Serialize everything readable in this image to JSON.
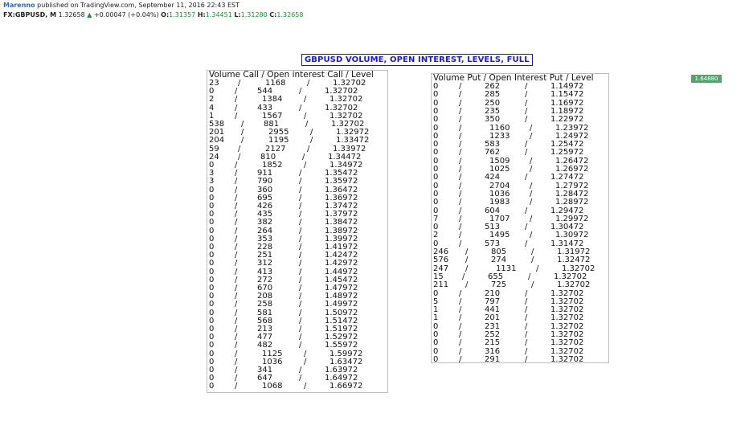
{
  "header": {
    "author": "Marenno",
    "published": "published on TradingView.com, September 11, 2016 22:43 EST",
    "symbol": "FX:GBPUSD, M",
    "last": "1.32658",
    "change": "+0.00047 (+0.04%)",
    "o_label": "O:",
    "o_value": "1.31357",
    "h_label": "H:",
    "h_value": "1.34451",
    "l_label": "L:",
    "l_value": "1.31280",
    "c_label": "C:",
    "c_value": "1.32658"
  },
  "title": "GBPUSD VOLUME, OPEN INTEREST, LEVELS, FULL",
  "price_tag": "1.64880",
  "calls": {
    "header": "Volume Call / Open interest Call / Level",
    "rows": [
      [
        "23",
        "1168",
        "1.32702"
      ],
      [
        "0",
        "544",
        "1.32702"
      ],
      [
        "2",
        "1384",
        "1.32702"
      ],
      [
        "4",
        "433",
        "1.32702"
      ],
      [
        "1",
        "1567",
        "1.32702"
      ],
      [
        "538",
        "881",
        "1.32702"
      ],
      [
        "201",
        "2955",
        "1.32972"
      ],
      [
        "204",
        "1195",
        "1.33472"
      ],
      [
        "59",
        "2127",
        "1.33972"
      ],
      [
        "24",
        "810",
        "1.34472"
      ],
      [
        "0",
        "1852",
        "1.34972"
      ],
      [
        "3",
        "911",
        "1.35472"
      ],
      [
        "3",
        "790",
        "1.35972"
      ],
      [
        "0",
        "360",
        "1.36472"
      ],
      [
        "0",
        "695",
        "1.36972"
      ],
      [
        "0",
        "426",
        "1.37472"
      ],
      [
        "0",
        "435",
        "1.37972"
      ],
      [
        "0",
        "382",
        "1.38472"
      ],
      [
        "0",
        "264",
        "1.38972"
      ],
      [
        "0",
        "353",
        "1.39972"
      ],
      [
        "0",
        "228",
        "1.41972"
      ],
      [
        "0",
        "251",
        "1.42472"
      ],
      [
        "0",
        "312",
        "1.42972"
      ],
      [
        "0",
        "413",
        "1.44972"
      ],
      [
        "0",
        "272",
        "1.45472"
      ],
      [
        "0",
        "670",
        "1.47972"
      ],
      [
        "0",
        "208",
        "1.48972"
      ],
      [
        "0",
        "258",
        "1.49972"
      ],
      [
        "0",
        "581",
        "1.50972"
      ],
      [
        "0",
        "568",
        "1.51472"
      ],
      [
        "0",
        "213",
        "1.51972"
      ],
      [
        "0",
        "477",
        "1.52972"
      ],
      [
        "0",
        "482",
        "1.55972"
      ],
      [
        "0",
        "1125",
        "1.59972"
      ],
      [
        "0",
        "1036",
        "1.63472"
      ],
      [
        "0",
        "341",
        "1.63972"
      ],
      [
        "0",
        "647",
        "1.64972"
      ],
      [
        "0",
        "1068",
        "1.66972"
      ]
    ]
  },
  "puts": {
    "header": "Volume Put / Open Interest Put / Level",
    "rows": [
      [
        "0",
        "262",
        "1.14972"
      ],
      [
        "0",
        "285",
        "1.15472"
      ],
      [
        "0",
        "250",
        "1.16972"
      ],
      [
        "0",
        "235",
        "1.18972"
      ],
      [
        "0",
        "350",
        "1.22972"
      ],
      [
        "0",
        "1160",
        "1.23972"
      ],
      [
        "0",
        "1233",
        "1.24972"
      ],
      [
        "0",
        "583",
        "1.25472"
      ],
      [
        "0",
        "762",
        "1.25972"
      ],
      [
        "0",
        "1509",
        "1.26472"
      ],
      [
        "0",
        "1025",
        "1.26972"
      ],
      [
        "0",
        "424",
        "1.27472"
      ],
      [
        "0",
        "2704",
        "1.27972"
      ],
      [
        "0",
        "1036",
        "1.28472"
      ],
      [
        "0",
        "1983",
        "1.28972"
      ],
      [
        "0",
        "604",
        "1.29472"
      ],
      [
        "7",
        "1707",
        "1.29972"
      ],
      [
        "0",
        "513",
        "1.30472"
      ],
      [
        "2",
        "1495",
        "1.30972"
      ],
      [
        "0",
        "573",
        "1.31472"
      ],
      [
        "246",
        "805",
        "1.31972"
      ],
      [
        "576",
        "274",
        "1.32472"
      ],
      [
        "247",
        "1131",
        "1.32702"
      ],
      [
        "15",
        "655",
        "1.32702"
      ],
      [
        "211",
        "725",
        "1.32702"
      ],
      [
        "0",
        "210",
        "1.32702"
      ],
      [
        "5",
        "797",
        "1.32702"
      ],
      [
        "1",
        "441",
        "1.32702"
      ],
      [
        "1",
        "201",
        "1.32702"
      ],
      [
        "0",
        "231",
        "1.32702"
      ],
      [
        "0",
        "252",
        "1.32702"
      ],
      [
        "0",
        "215",
        "1.32702"
      ],
      [
        "0",
        "316",
        "1.32702"
      ],
      [
        "0",
        "291",
        "1.32702"
      ]
    ]
  }
}
